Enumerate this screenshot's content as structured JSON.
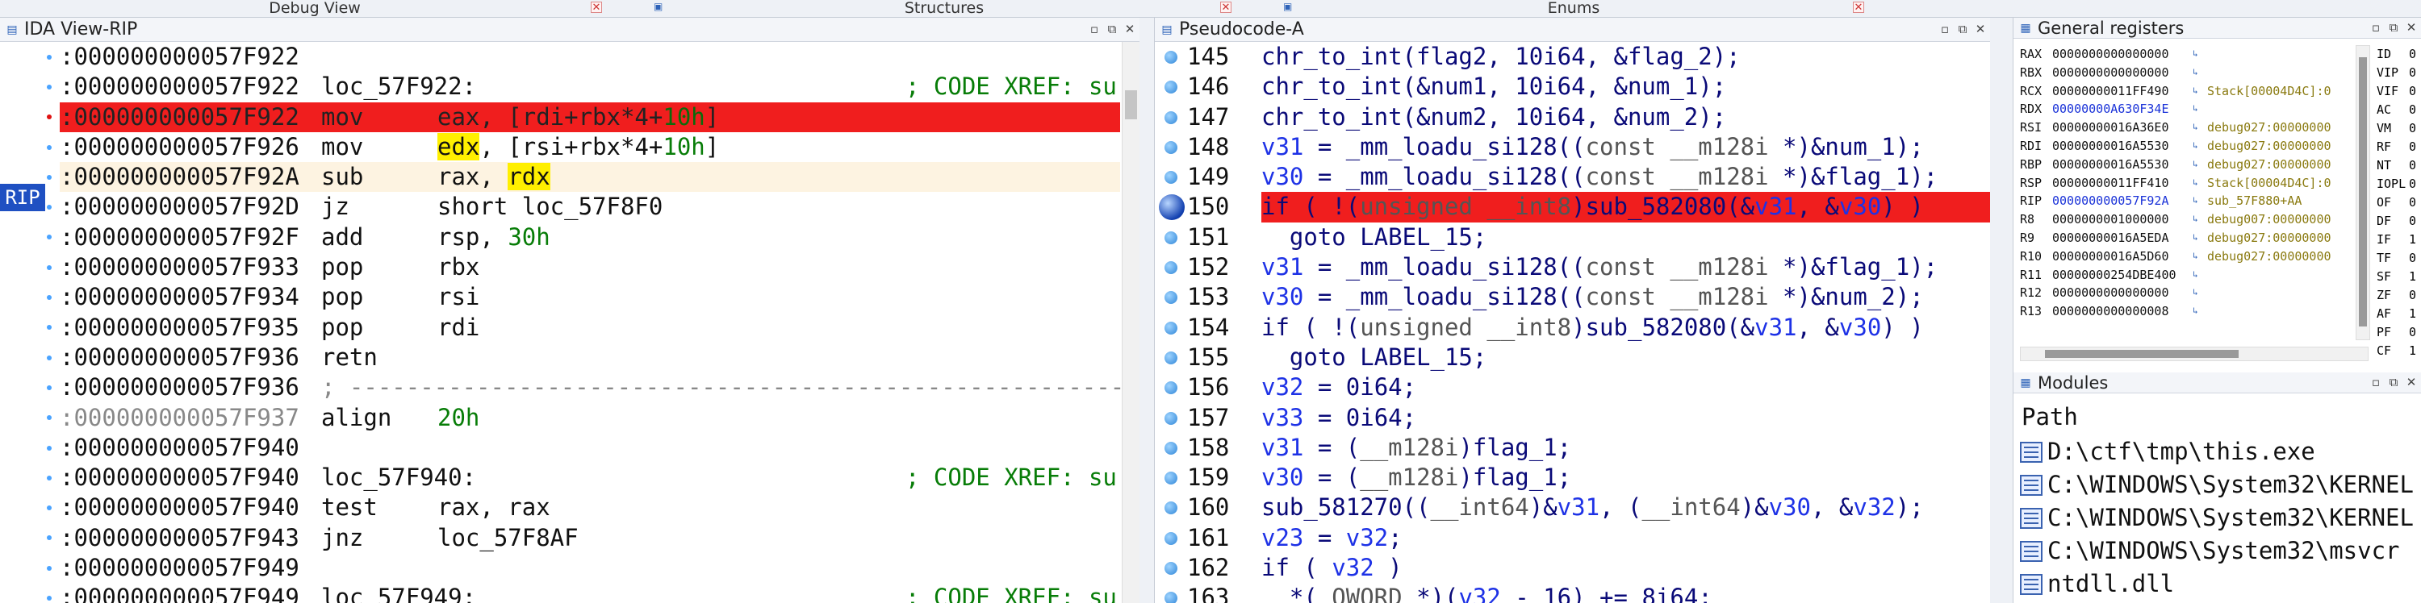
{
  "tabs": {
    "debug_view": "Debug View",
    "structures": "Structures",
    "enums": "Enums"
  },
  "ida": {
    "title": "IDA View-RIP",
    "rip_badge": "RIP",
    "lines": [
      {
        "addr": ":000000000057F922",
        "mnem": "",
        "ops": "",
        "style": ""
      },
      {
        "addr": ":000000000057F922",
        "label": "loc_57F922:",
        "xref": "; CODE XREF: su",
        "style": ""
      },
      {
        "addr": ":000000000057F922",
        "mnem": "mov",
        "ops_pre": "eax, [rdi+rbx*4+",
        "ops_num": "10h",
        "ops_post": "]",
        "style": "red"
      },
      {
        "addr": ":000000000057F926",
        "mnem": "mov",
        "reg_hl": "edx",
        "ops_pre": ", [rsi+rbx*4+",
        "ops_num": "10h",
        "ops_post": "]",
        "style": ""
      },
      {
        "addr": ":000000000057F92A",
        "mnem": "sub",
        "ops_pre": "rax, ",
        "reg_hl2": "rdx",
        "style": "cream"
      },
      {
        "addr": ":000000000057F92D",
        "mnem": "jz",
        "ops_pre": "short loc_57F8F0",
        "style": ""
      },
      {
        "addr": ":000000000057F92F",
        "mnem": "add",
        "ops_pre": "rsp, ",
        "ops_num": "30h",
        "style": ""
      },
      {
        "addr": ":000000000057F933",
        "mnem": "pop",
        "ops_pre": "rbx",
        "style": ""
      },
      {
        "addr": ":000000000057F934",
        "mnem": "pop",
        "ops_pre": "rsi",
        "style": ""
      },
      {
        "addr": ":000000000057F935",
        "mnem": "pop",
        "ops_pre": "rdi",
        "style": ""
      },
      {
        "addr": ":000000000057F936",
        "mnem": "retn",
        "style": ""
      },
      {
        "addr": ":000000000057F936",
        "comment": "; -----------------------------------------------------------------",
        "style": ""
      },
      {
        "addr": ":000000000057F937",
        "mnem": "align",
        "ops_num": "20h",
        "dim": true,
        "style": ""
      },
      {
        "addr": ":000000000057F940",
        "style": ""
      },
      {
        "addr": ":000000000057F940",
        "label": "loc_57F940:",
        "xref": "; CODE XREF: su",
        "style": ""
      },
      {
        "addr": ":000000000057F940",
        "mnem": "test",
        "ops_pre": "rax, rax",
        "style": ""
      },
      {
        "addr": ":000000000057F943",
        "mnem": "jnz",
        "ops_pre": "loc_57F8AF",
        "style": ""
      },
      {
        "addr": ":000000000057F949",
        "style": ""
      },
      {
        "addr": ":000000000057F949",
        "label": "loc_57F949:",
        "xref": "; CODE XREF: su",
        "style": ""
      }
    ]
  },
  "pseudo": {
    "title": "Pseudocode-A",
    "lines": [
      {
        "n": "145",
        "code": "chr_to_int(flag2, 10i64, &flag_2);"
      },
      {
        "n": "146",
        "code": "chr_to_int(&num1, 10i64, &num_1);"
      },
      {
        "n": "147",
        "code": "chr_to_int(&num2, 10i64, &num_2);"
      },
      {
        "n": "148",
        "code": "v31 = _mm_loadu_si128((const __m128i *)&num_1);"
      },
      {
        "n": "149",
        "code": "v30 = _mm_loadu_si128((const __m128i *)&flag_1);"
      },
      {
        "n": "150",
        "code": "if ( !(unsigned __int8)sub_582080(&v31, &v30) )",
        "current": true
      },
      {
        "n": "151",
        "code": "  goto LABEL_15;"
      },
      {
        "n": "152",
        "code": "v31 = _mm_loadu_si128((const __m128i *)&flag_1);"
      },
      {
        "n": "153",
        "code": "v30 = _mm_loadu_si128((const __m128i *)&num_2);"
      },
      {
        "n": "154",
        "code": "if ( !(unsigned __int8)sub_582080(&v31, &v30) )"
      },
      {
        "n": "155",
        "code": "  goto LABEL_15;"
      },
      {
        "n": "156",
        "code": "v32 = 0i64;"
      },
      {
        "n": "157",
        "code": "v33 = 0i64;"
      },
      {
        "n": "158",
        "code": "v31 = (__m128i)flag_1;"
      },
      {
        "n": "159",
        "code": "v30 = (__m128i)flag_1;"
      },
      {
        "n": "160",
        "code": "sub_581270((__int64)&v31, (__int64)&v30, &v32);"
      },
      {
        "n": "161",
        "code": "v23 = v32;"
      },
      {
        "n": "162",
        "code": "if ( v32 )"
      },
      {
        "n": "163",
        "code": "  *(_QWORD *)(v32 - 16) += 8i64;"
      }
    ]
  },
  "regs": {
    "title": "General registers",
    "rows": [
      {
        "name": "RAX",
        "value": "0000000000000000",
        "hint": ""
      },
      {
        "name": "RBX",
        "value": "0000000000000000",
        "hint": ""
      },
      {
        "name": "RCX",
        "value": "00000000011FF490",
        "hint": "Stack[00004D4C]:0"
      },
      {
        "name": "RDX",
        "value": "00000000A630F34E",
        "hint": "",
        "blue": true
      },
      {
        "name": "RSI",
        "value": "00000000016A36E0",
        "hint": "debug027:00000000"
      },
      {
        "name": "RDI",
        "value": "00000000016A5530",
        "hint": "debug027:00000000"
      },
      {
        "name": "RBP",
        "value": "00000000016A5530",
        "hint": "debug027:00000000"
      },
      {
        "name": "RSP",
        "value": "00000000011FF410",
        "hint": "Stack[00004D4C]:0"
      },
      {
        "name": "RIP",
        "value": "000000000057F92A",
        "hint": "sub_57F880+AA",
        "blue": true
      },
      {
        "name": "R8",
        "value": "0000000001000000",
        "hint": "debug007:00000000"
      },
      {
        "name": "R9",
        "value": "00000000016A5EDA",
        "hint": "debug027:00000000"
      },
      {
        "name": "R10",
        "value": "00000000016A5D60",
        "hint": "debug027:00000000"
      },
      {
        "name": "R11",
        "value": "00000000254DBE400",
        "hint": ""
      },
      {
        "name": "R12",
        "value": "0000000000000000",
        "hint": ""
      },
      {
        "name": "R13",
        "value": "0000000000000008",
        "hint": ""
      }
    ],
    "flags": [
      {
        "name": "ID",
        "value": "0"
      },
      {
        "name": "VIP",
        "value": "0"
      },
      {
        "name": "VIF",
        "value": "0"
      },
      {
        "name": "AC",
        "value": "0"
      },
      {
        "name": "VM",
        "value": "0"
      },
      {
        "name": "RF",
        "value": "0"
      },
      {
        "name": "NT",
        "value": "0"
      },
      {
        "name": "IOPL",
        "value": "0"
      },
      {
        "name": "OF",
        "value": "0"
      },
      {
        "name": "DF",
        "value": "0"
      },
      {
        "name": "IF",
        "value": "1"
      },
      {
        "name": "TF",
        "value": "0"
      },
      {
        "name": "SF",
        "value": "1"
      },
      {
        "name": "ZF",
        "value": "0"
      },
      {
        "name": "AF",
        "value": "1"
      },
      {
        "name": "PF",
        "value": "0"
      },
      {
        "name": "CF",
        "value": "1"
      }
    ]
  },
  "modules": {
    "title": "Modules",
    "header": "Path",
    "items": [
      "D:\\ctf\\tmp\\this.exe",
      "C:\\WINDOWS\\System32\\KERNEL",
      "C:\\WINDOWS\\System32\\KERNEL",
      "C:\\WINDOWS\\System32\\msvcr",
      "ntdll.dll"
    ]
  },
  "colors": {
    "current_line": "#f01e1e",
    "register_highlight": "#ffef00",
    "code_blue": "#1e32e6",
    "xref_green": "#087d08",
    "rip_badge": "#1f50c2"
  }
}
